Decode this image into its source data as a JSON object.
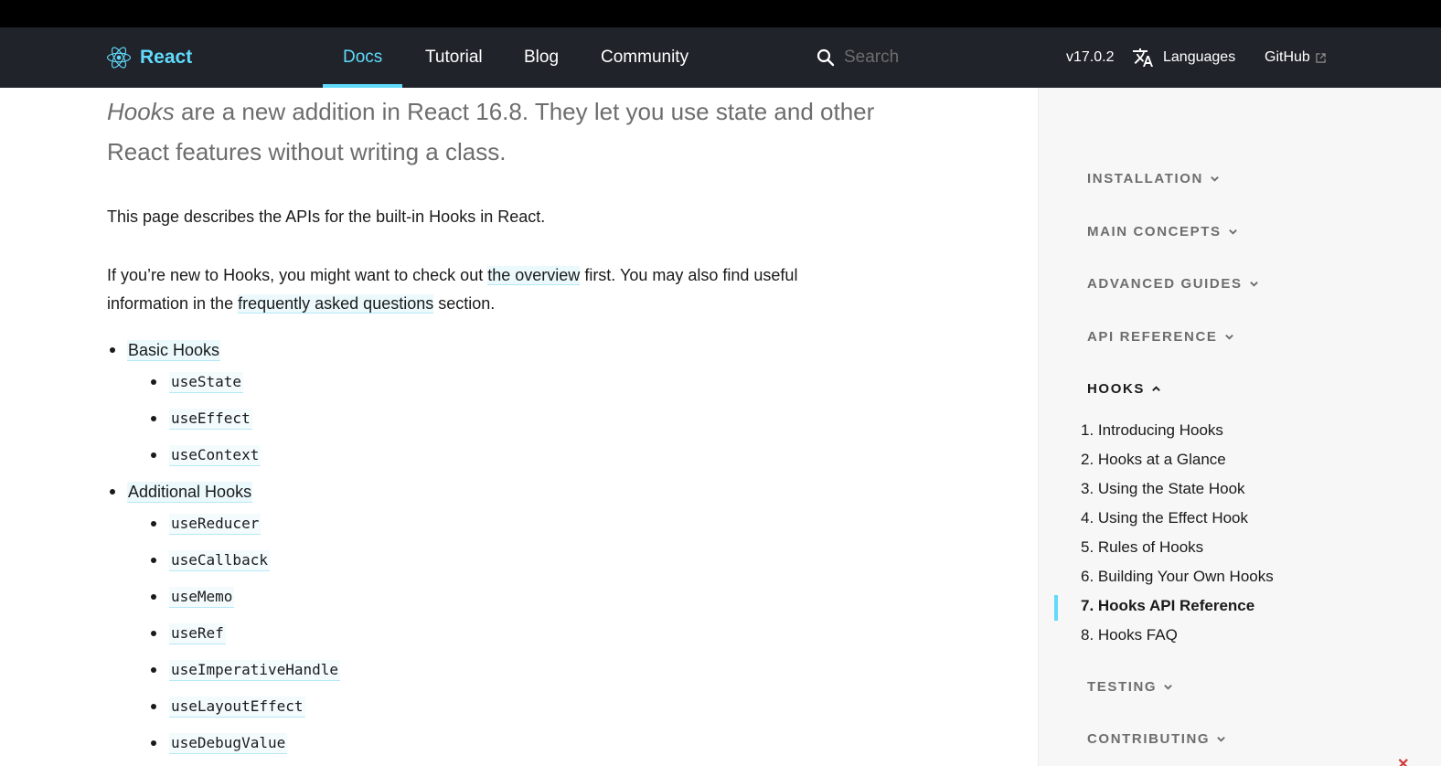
{
  "nav": {
    "brand": "React",
    "links": [
      "Docs",
      "Tutorial",
      "Blog",
      "Community"
    ],
    "active_link": "Docs",
    "search_placeholder": "Search",
    "version": "v17.0.2",
    "languages": "Languages",
    "github": "GitHub",
    "accent_color": "#61dafb",
    "bg_color": "#20232a"
  },
  "main": {
    "lead_em": "Hooks",
    "lead_rest": "are a new addition in React 16.8. They let you use state and other React features without writing a class.",
    "para1": "This page describes the APIs for the built-in Hooks in React.",
    "para2_a": "If you’re new to Hooks, you might want to check out",
    "para2_link1": "the overview",
    "para2_b": "first. You may also find useful information in the",
    "para2_link2": "frequently asked questions",
    "para2_c": "section.",
    "groups": [
      {
        "label": "Basic Hooks",
        "items": [
          "useState",
          "useEffect",
          "useContext"
        ]
      },
      {
        "label": "Additional Hooks",
        "items": [
          "useReducer",
          "useCallback",
          "useMemo",
          "useRef",
          "useImperativeHandle",
          "useLayoutEffect",
          "useDebugValue"
        ]
      }
    ]
  },
  "sidebar": {
    "sections": [
      "INSTALLATION",
      "MAIN CONCEPTS",
      "ADVANCED GUIDES",
      "API REFERENCE",
      "HOOKS",
      "TESTING",
      "CONTRIBUTING"
    ],
    "open_section": "HOOKS",
    "hooks_items": [
      "1. Introducing Hooks",
      "2. Hooks at a Glance",
      "3. Using the State Hook",
      "4. Using the Effect Hook",
      "5. Rules of Hooks",
      "6. Building Your Own Hooks",
      "7. Hooks API Reference",
      "8. Hooks FAQ"
    ],
    "current_item": "7. Hooks API Reference"
  },
  "icons": [
    "react-logo-icon",
    "search-icon",
    "translate-icon",
    "external-link-icon",
    "chevron-down-icon",
    "chevron-up-icon"
  ]
}
